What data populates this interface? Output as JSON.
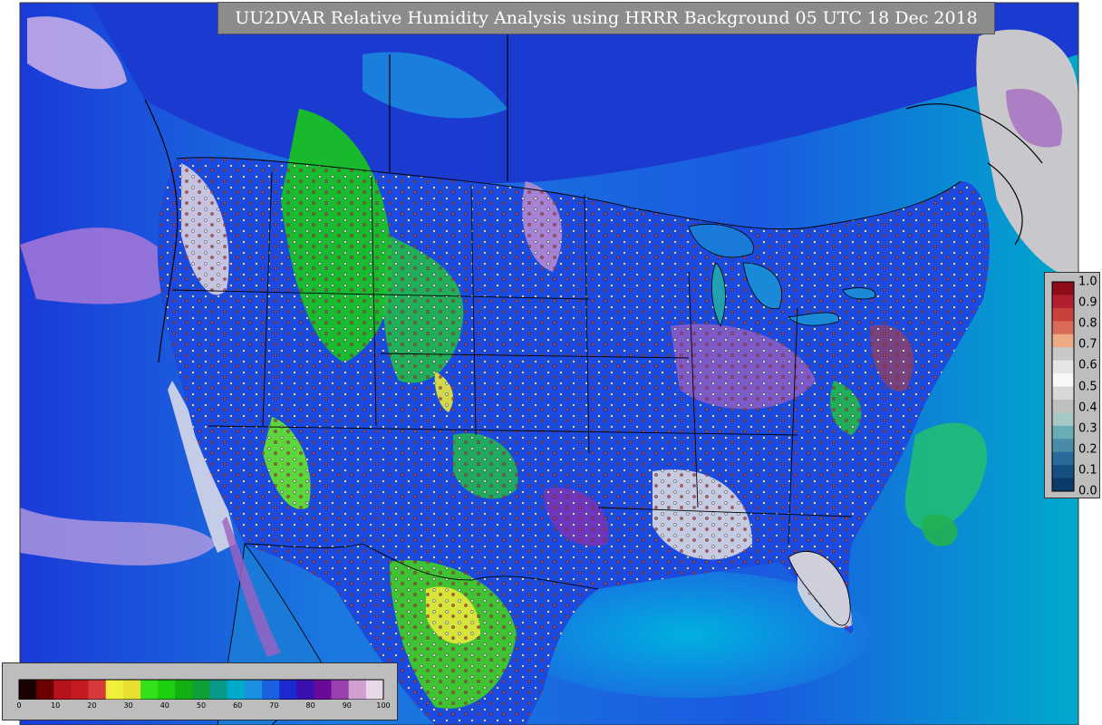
{
  "map": {
    "title": "UU2DVAR Relative Humidity Analysis using HRRR Background 05 UTC 18 Dec 2018"
  },
  "humidity_colorbar": {
    "ticks": [
      "0",
      "10",
      "20",
      "30",
      "40",
      "50",
      "60",
      "70",
      "80",
      "90",
      "100"
    ],
    "colors": [
      "#1a0000",
      "#6b0000",
      "#b5121b",
      "#c41a22",
      "#d63a3a",
      "#f0f03a",
      "#e8e030",
      "#33e01a",
      "#1ad010",
      "#12b010",
      "#0ea036",
      "#0a9a8a",
      "#00aacc",
      "#1a90e0",
      "#1a60e0",
      "#1a2ad0",
      "#3a10b0",
      "#6a0a9a",
      "#9a40b0",
      "#d0a0d0",
      "#e8d8e8"
    ]
  },
  "residual_colorbar": {
    "ticks": [
      "1.0",
      "0.9",
      "0.8",
      "0.7",
      "0.6",
      "0.5",
      "0.4",
      "0.3",
      "0.2",
      "0.1",
      "0.0"
    ],
    "colors": [
      "#8e0c1a",
      "#b22030",
      "#c8423c",
      "#dc6a58",
      "#eeaa82",
      "#c8c8c8",
      "#e6e6e6",
      "#f8f8f8",
      "#d8d8d8",
      "#c0c0c0",
      "#a8c8c8",
      "#6aacb4",
      "#4a8ca8",
      "#2a6a9a",
      "#154e80",
      "#0a3a6a"
    ]
  },
  "colors": {
    "title_bg": "#8c8c8c",
    "panel_bg": "#bdbdbd",
    "ocean": "#1a5fd8"
  }
}
